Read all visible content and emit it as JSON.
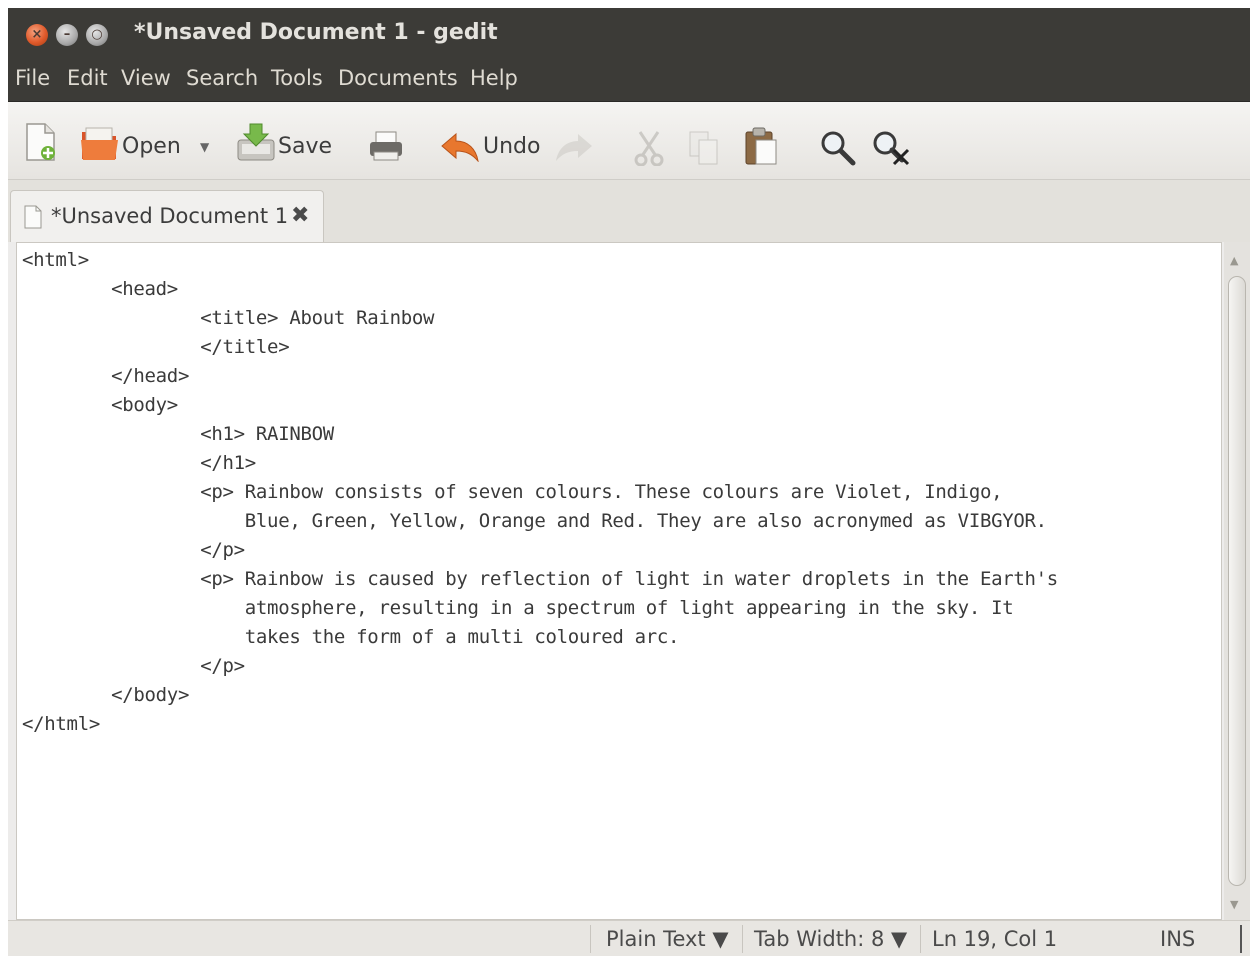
{
  "window": {
    "title": "*Unsaved Document 1 - gedit",
    "buttons": {
      "close_glyph": "×",
      "minimize_glyph": "–",
      "maximize_glyph": "○"
    }
  },
  "menubar": {
    "items": [
      "File",
      "Edit",
      "View",
      "Search",
      "Tools",
      "Documents",
      "Help"
    ]
  },
  "toolbar": {
    "new_icon": "new-document-icon",
    "open_label": "Open",
    "open_dropdown_glyph": "▼",
    "save_label": "Save",
    "print_icon": "print-icon",
    "undo_label": "Undo",
    "redo_icon": "redo-icon",
    "cut_icon": "cut-icon",
    "copy_icon": "copy-icon",
    "paste_icon": "paste-icon",
    "find_icon": "search-icon",
    "replace_icon": "find-replace-icon"
  },
  "tab": {
    "label": "*Unsaved Document 1",
    "close_glyph": "✖"
  },
  "editor": {
    "lines": [
      "<html>",
      "        <head>",
      "                <title> About Rainbow",
      "                </title>",
      "        </head>",
      "        <body>",
      "                <h1> RAINBOW",
      "                </h1>",
      "                <p> Rainbow consists of seven colours. These colours are Violet, Indigo,",
      "                    Blue, Green, Yellow, Orange and Red. They are also acronymed as VIBGYOR.",
      "                </p>",
      "                <p> Rainbow is caused by reflection of light in water droplets in the Earth's",
      "                    atmosphere, resulting in a spectrum of light appearing in the sky. It",
      "                    takes the form of a multi coloured arc.",
      "                </p>",
      "        </body>",
      "</html>"
    ]
  },
  "statusbar": {
    "language": "Plain Text ▼",
    "tab_width": "Tab Width:  8 ▼",
    "position": "Ln 19, Col 1",
    "mode": "INS"
  },
  "colors": {
    "titlebar": "#3c3b37",
    "close_button": "#e05a2b",
    "undo_arrow": "#e8772e"
  }
}
